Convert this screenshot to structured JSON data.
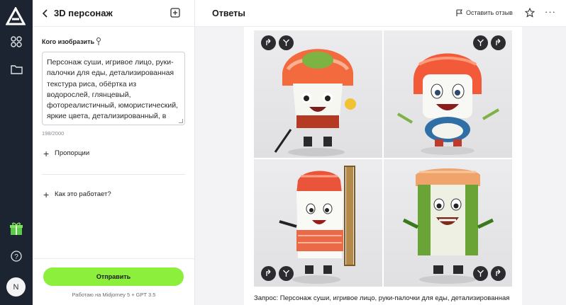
{
  "rail": {
    "avatar_initial": "N"
  },
  "panel": {
    "title": "3D персонаж",
    "field_label": "Кого изобразить",
    "prompt_text": "Персонаж суши, игривое лицо, руки-палочки для еды, детализированная текстура риса, обёртка из водорослей, глянцевый, фотореалистичный, юмористический, яркие цвета, детализированный, в",
    "char_counter": "198/2000",
    "proportions_label": "Пропорции",
    "how_it_works_label": "Как это работает?",
    "submit_label": "Отправить",
    "powered_by": "Работаю на Midjorney 5 + GPT 3.5"
  },
  "main": {
    "title": "Ответы",
    "feedback_label": "Оставить отзыв",
    "more_label": "···",
    "query_text": "Запрос: Персонаж суши, игривое лицо, руки-палочки для еды, детализированная"
  },
  "colors": {
    "rail_bg": "#1b2430",
    "accent_green": "#8bef3c",
    "control_dark": "#2b2b30"
  }
}
